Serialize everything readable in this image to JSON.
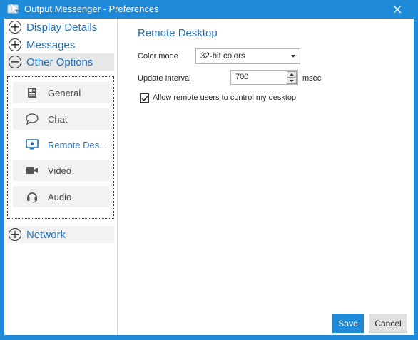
{
  "window": {
    "title": "Output Messenger - Preferences",
    "accent_color": "#1f8ad8"
  },
  "sidebar": {
    "sections": [
      {
        "label": "Display Details",
        "icon": "plus-circle-icon"
      },
      {
        "label": "Messages",
        "icon": "plus-circle-icon"
      },
      {
        "label": "Other Options",
        "icon": "minus-circle-icon",
        "expanded": true
      },
      {
        "label": "Network",
        "icon": "plus-circle-icon"
      }
    ],
    "sub_items": [
      {
        "label": "General",
        "icon": "general-settings-icon"
      },
      {
        "label": "Chat",
        "icon": "chat-bubble-icon"
      },
      {
        "label": "Remote Des...",
        "icon": "monitor-icon",
        "selected": true
      },
      {
        "label": "Video",
        "icon": "video-camera-icon"
      },
      {
        "label": "Audio",
        "icon": "headset-icon"
      }
    ]
  },
  "content": {
    "title": "Remote Desktop",
    "color_mode": {
      "label": "Color mode",
      "value": "32-bit colors"
    },
    "update_interval": {
      "label": "Update Interval",
      "value": "700",
      "unit": "msec"
    },
    "allow_control": {
      "label": "Allow remote users to control my desktop",
      "checked": true
    }
  },
  "buttons": {
    "save": "Save",
    "cancel": "Cancel"
  }
}
